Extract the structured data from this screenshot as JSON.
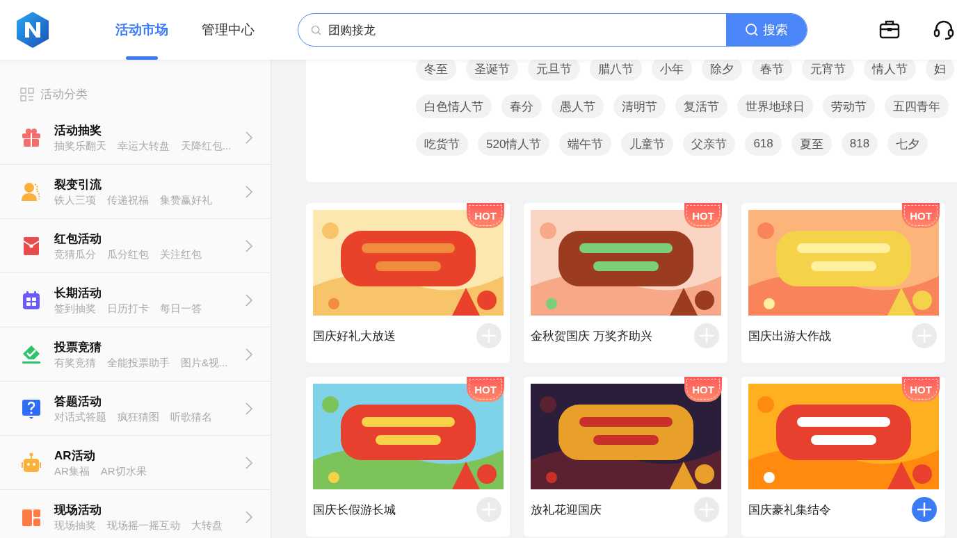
{
  "header": {
    "tabs": [
      {
        "label": "活动市场",
        "selected": true
      },
      {
        "label": "管理中心",
        "selected": false
      }
    ],
    "search": {
      "value": "团购接龙",
      "button": "搜索"
    }
  },
  "sidebar": {
    "heading": "活动分类",
    "items": [
      {
        "title": "活动抽奖",
        "subs": [
          "抽奖乐翻天",
          "幸运大转盘",
          "天降红包..."
        ]
      },
      {
        "title": "裂变引流",
        "subs": [
          "铁人三项",
          "传递祝福",
          "集赞赢好礼"
        ]
      },
      {
        "title": "红包活动",
        "subs": [
          "竞猜瓜分",
          "瓜分红包",
          "关注红包"
        ]
      },
      {
        "title": "长期活动",
        "subs": [
          "签到抽奖",
          "日历打卡",
          "每日一答"
        ]
      },
      {
        "title": "投票竞猜",
        "subs": [
          "有奖竞猜",
          "全能投票助手",
          "图片&视..."
        ]
      },
      {
        "title": "答题活动",
        "subs": [
          "对话式答题",
          "疯狂猜图",
          "听歌猜名"
        ]
      },
      {
        "title": "AR活动",
        "subs": [
          "AR集福",
          "AR切水果"
        ]
      },
      {
        "title": "现场活动",
        "subs": [
          "现场抽奖",
          "现场摇一摇互动",
          "大转盘"
        ]
      }
    ]
  },
  "tag_rows": [
    [
      "冬至",
      "圣诞节",
      "元旦节",
      "腊八节",
      "小年",
      "除夕",
      "春节",
      "元宵节",
      "情人节",
      "妇"
    ],
    [
      "白色情人节",
      "春分",
      "愚人节",
      "清明节",
      "复活节",
      "世界地球日",
      "劳动节",
      "五四青年"
    ],
    [
      "吃货节",
      "520情人节",
      "端午节",
      "儿童节",
      "父亲节",
      "618",
      "夏至",
      "818",
      "七夕"
    ]
  ],
  "cards": [
    {
      "title": "国庆好礼大放送",
      "badge": "HOT",
      "active": false
    },
    {
      "title": "金秋贺国庆 万奖齐助兴",
      "badge": "HOT",
      "active": false
    },
    {
      "title": "国庆出游大作战",
      "badge": "HOT",
      "active": false
    },
    {
      "title": "国庆长假游长城",
      "badge": "HOT",
      "active": false
    },
    {
      "title": "放礼花迎国庆",
      "badge": "HOT",
      "active": false
    },
    {
      "title": "国庆豪礼集结令",
      "badge": "HOT",
      "active": true
    }
  ]
}
